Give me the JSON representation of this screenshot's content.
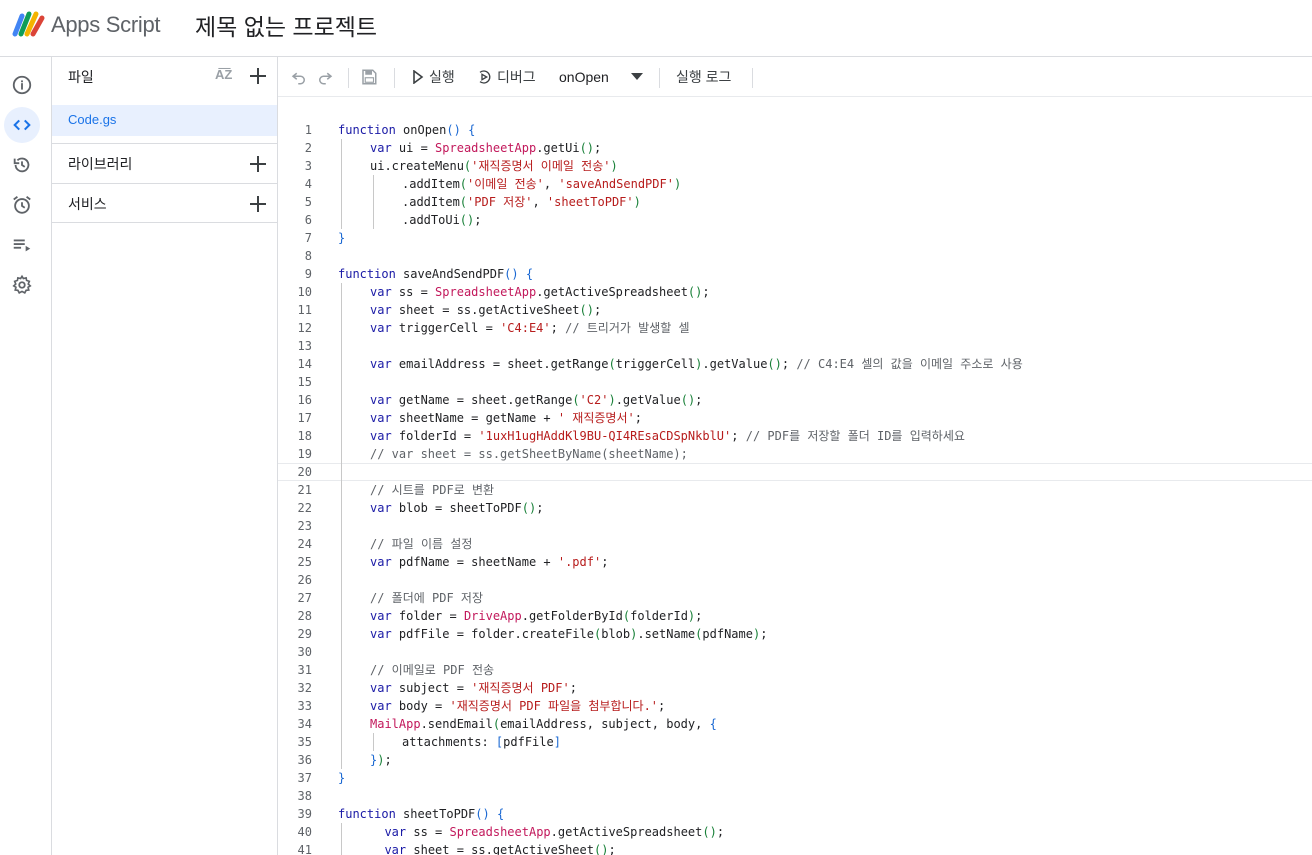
{
  "header": {
    "app_name": "Apps Script",
    "project_title": "제목 없는 프로젝트"
  },
  "rail": {
    "items": [
      "overview",
      "editor",
      "triggers-history",
      "triggers",
      "executions",
      "settings"
    ]
  },
  "files_panel": {
    "title": "파일",
    "files": [
      "Code.gs"
    ],
    "sections": [
      "라이브러리",
      "서비스"
    ]
  },
  "toolbar": {
    "run_label": "실행",
    "debug_label": "디버그",
    "function_selected": "onOpen",
    "log_label": "실행 로그"
  },
  "colors": {
    "accent": "#1a73e8",
    "selected_bg": "#e8f0fe",
    "keyword": "#1a1aa6",
    "class": "#c2185b",
    "string": "#b71c1c"
  },
  "code": {
    "current_line": 20,
    "lines": [
      {
        "n": "1",
        "indent": 0,
        "t": [
          [
            "kw",
            "function"
          ],
          [
            "fn",
            " onOpen"
          ],
          [
            "par1",
            "()"
          ],
          [
            "punc",
            " "
          ],
          [
            "par1",
            "{"
          ]
        ]
      },
      {
        "n": "2",
        "indent": 1,
        "t": [
          [
            "kw",
            "var"
          ],
          [
            "fn",
            " ui = "
          ],
          [
            "cls",
            "SpreadsheetApp"
          ],
          [
            "fn",
            ".getUi"
          ],
          [
            "par2",
            "()"
          ],
          [
            "punc",
            ";"
          ]
        ]
      },
      {
        "n": "3",
        "indent": 1,
        "t": [
          [
            "fn",
            "ui.createMenu"
          ],
          [
            "par2",
            "("
          ],
          [
            "str",
            "'재직증명서 이메일 전송'"
          ],
          [
            "par2",
            ")"
          ]
        ]
      },
      {
        "n": "4",
        "indent": 2,
        "t": [
          [
            "fn",
            ".addItem"
          ],
          [
            "par2",
            "("
          ],
          [
            "str",
            "'이메일 전송'"
          ],
          [
            "fn",
            ", "
          ],
          [
            "str",
            "'saveAndSendPDF'"
          ],
          [
            "par2",
            ")"
          ]
        ]
      },
      {
        "n": "5",
        "indent": 2,
        "t": [
          [
            "fn",
            ".addItem"
          ],
          [
            "par2",
            "("
          ],
          [
            "str",
            "'PDF 저장'"
          ],
          [
            "fn",
            ", "
          ],
          [
            "str",
            "'sheetToPDF'"
          ],
          [
            "par2",
            ")"
          ]
        ]
      },
      {
        "n": "6",
        "indent": 2,
        "t": [
          [
            "fn",
            ".addToUi"
          ],
          [
            "par2",
            "()"
          ],
          [
            "punc",
            ";"
          ]
        ]
      },
      {
        "n": "7",
        "indent": 0,
        "t": [
          [
            "par1",
            "}"
          ]
        ]
      },
      {
        "n": "8",
        "indent": 0,
        "t": []
      },
      {
        "n": "9",
        "indent": 0,
        "t": [
          [
            "kw",
            "function"
          ],
          [
            "fn",
            " saveAndSendPDF"
          ],
          [
            "par1",
            "()"
          ],
          [
            "punc",
            " "
          ],
          [
            "par1",
            "{"
          ]
        ]
      },
      {
        "n": "10",
        "indent": 1,
        "t": [
          [
            "kw",
            "var"
          ],
          [
            "fn",
            " ss = "
          ],
          [
            "cls",
            "SpreadsheetApp"
          ],
          [
            "fn",
            ".getActiveSpreadsheet"
          ],
          [
            "par2",
            "()"
          ],
          [
            "punc",
            ";"
          ]
        ]
      },
      {
        "n": "11",
        "indent": 1,
        "t": [
          [
            "kw",
            "var"
          ],
          [
            "fn",
            " sheet = ss.getActiveSheet"
          ],
          [
            "par2",
            "()"
          ],
          [
            "punc",
            ";"
          ]
        ]
      },
      {
        "n": "12",
        "indent": 1,
        "t": [
          [
            "kw",
            "var"
          ],
          [
            "fn",
            " triggerCell = "
          ],
          [
            "str",
            "'C4:E4'"
          ],
          [
            "punc",
            "; "
          ],
          [
            "cm",
            "// 트리거가 발생할 셀"
          ]
        ]
      },
      {
        "n": "13",
        "indent": 1,
        "t": []
      },
      {
        "n": "14",
        "indent": 1,
        "t": [
          [
            "kw",
            "var"
          ],
          [
            "fn",
            " emailAddress = sheet.getRange"
          ],
          [
            "par2",
            "("
          ],
          [
            "fn",
            "triggerCell"
          ],
          [
            "par2",
            ")"
          ],
          [
            "fn",
            ".getValue"
          ],
          [
            "par2",
            "()"
          ],
          [
            "punc",
            "; "
          ],
          [
            "cm",
            "// C4:E4 셀의 값을 이메일 주소로 사용"
          ]
        ]
      },
      {
        "n": "15",
        "indent": 1,
        "t": []
      },
      {
        "n": "16",
        "indent": 1,
        "t": [
          [
            "kw",
            "var"
          ],
          [
            "fn",
            " getName = sheet.getRange"
          ],
          [
            "par2",
            "("
          ],
          [
            "str",
            "'C2'"
          ],
          [
            "par2",
            ")"
          ],
          [
            "fn",
            ".getValue"
          ],
          [
            "par2",
            "()"
          ],
          [
            "punc",
            ";"
          ]
        ]
      },
      {
        "n": "17",
        "indent": 1,
        "t": [
          [
            "kw",
            "var"
          ],
          [
            "fn",
            " sheetName = getName + "
          ],
          [
            "str",
            "' 재직증명서'"
          ],
          [
            "punc",
            ";"
          ]
        ]
      },
      {
        "n": "18",
        "indent": 1,
        "t": [
          [
            "kw",
            "var"
          ],
          [
            "fn",
            " folderId = "
          ],
          [
            "str",
            "'1uxH1ugHAddKl9BU-QI4REsaCDSpNkblU'"
          ],
          [
            "punc",
            "; "
          ],
          [
            "cm",
            "// PDF를 저장할 폴더 ID를 입력하세요"
          ]
        ]
      },
      {
        "n": "19",
        "indent": 1,
        "t": [
          [
            "cm",
            "// var sheet = ss.getSheetByName(sheetName);"
          ]
        ]
      },
      {
        "n": "20",
        "indent": 1,
        "t": []
      },
      {
        "n": "21",
        "indent": 1,
        "t": [
          [
            "cm",
            "// 시트를 PDF로 변환"
          ]
        ]
      },
      {
        "n": "22",
        "indent": 1,
        "t": [
          [
            "kw",
            "var"
          ],
          [
            "fn",
            " blob = sheetToPDF"
          ],
          [
            "par2",
            "()"
          ],
          [
            "punc",
            ";"
          ]
        ]
      },
      {
        "n": "23",
        "indent": 1,
        "t": []
      },
      {
        "n": "24",
        "indent": 1,
        "t": [
          [
            "cm",
            "// 파일 이름 설정"
          ]
        ]
      },
      {
        "n": "25",
        "indent": 1,
        "t": [
          [
            "kw",
            "var"
          ],
          [
            "fn",
            " pdfName = sheetName + "
          ],
          [
            "str",
            "'.pdf'"
          ],
          [
            "punc",
            ";"
          ]
        ]
      },
      {
        "n": "26",
        "indent": 1,
        "t": []
      },
      {
        "n": "27",
        "indent": 1,
        "t": [
          [
            "cm",
            "// 폴더에 PDF 저장"
          ]
        ]
      },
      {
        "n": "28",
        "indent": 1,
        "t": [
          [
            "kw",
            "var"
          ],
          [
            "fn",
            " folder = "
          ],
          [
            "cls",
            "DriveApp"
          ],
          [
            "fn",
            ".getFolderById"
          ],
          [
            "par2",
            "("
          ],
          [
            "fn",
            "folderId"
          ],
          [
            "par2",
            ")"
          ],
          [
            "punc",
            ";"
          ]
        ]
      },
      {
        "n": "29",
        "indent": 1,
        "t": [
          [
            "kw",
            "var"
          ],
          [
            "fn",
            " pdfFile = folder.createFile"
          ],
          [
            "par2",
            "("
          ],
          [
            "fn",
            "blob"
          ],
          [
            "par2",
            ")"
          ],
          [
            "fn",
            ".setName"
          ],
          [
            "par2",
            "("
          ],
          [
            "fn",
            "pdfName"
          ],
          [
            "par2",
            ")"
          ],
          [
            "punc",
            ";"
          ]
        ]
      },
      {
        "n": "30",
        "indent": 1,
        "t": []
      },
      {
        "n": "31",
        "indent": 1,
        "t": [
          [
            "cm",
            "// 이메일로 PDF 전송"
          ]
        ]
      },
      {
        "n": "32",
        "indent": 1,
        "t": [
          [
            "kw",
            "var"
          ],
          [
            "fn",
            " subject = "
          ],
          [
            "str",
            "'재직증명서 PDF'"
          ],
          [
            "punc",
            ";"
          ]
        ]
      },
      {
        "n": "33",
        "indent": 1,
        "t": [
          [
            "kw",
            "var"
          ],
          [
            "fn",
            " body = "
          ],
          [
            "str",
            "'재직증명서 PDF 파일을 첨부합니다.'"
          ],
          [
            "punc",
            ";"
          ]
        ]
      },
      {
        "n": "34",
        "indent": 1,
        "t": [
          [
            "cls",
            "MailApp"
          ],
          [
            "fn",
            ".sendEmail"
          ],
          [
            "par2",
            "("
          ],
          [
            "fn",
            "emailAddress, subject, body, "
          ],
          [
            "par1",
            "{"
          ]
        ]
      },
      {
        "n": "35",
        "indent": 2,
        "t": [
          [
            "fn",
            "attachments: "
          ],
          [
            "par1",
            "["
          ],
          [
            "fn",
            "pdfFile"
          ],
          [
            "par1",
            "]"
          ]
        ]
      },
      {
        "n": "36",
        "indent": 1,
        "t": [
          [
            "par1",
            "}"
          ],
          [
            "par2",
            ")"
          ],
          [
            "punc",
            ";"
          ]
        ]
      },
      {
        "n": "37",
        "indent": 0,
        "t": [
          [
            "par1",
            "}"
          ]
        ]
      },
      {
        "n": "38",
        "indent": 0,
        "t": []
      },
      {
        "n": "39",
        "indent": 0,
        "t": [
          [
            "kw",
            "function"
          ],
          [
            "fn",
            " sheetToPDF"
          ],
          [
            "par1",
            "()"
          ],
          [
            "punc",
            " "
          ],
          [
            "par1",
            "{"
          ]
        ]
      },
      {
        "n": "40",
        "indent": 1,
        "t": [
          [
            "fn",
            "  "
          ],
          [
            "kw",
            "var"
          ],
          [
            "fn",
            " ss = "
          ],
          [
            "cls",
            "SpreadsheetApp"
          ],
          [
            "fn",
            ".getActiveSpreadsheet"
          ],
          [
            "par2",
            "()"
          ],
          [
            "punc",
            ";"
          ]
        ]
      },
      {
        "n": "41",
        "indent": 1,
        "t": [
          [
            "fn",
            "  "
          ],
          [
            "kw",
            "var"
          ],
          [
            "fn",
            " sheet = ss.getActiveSheet"
          ],
          [
            "par2",
            "()"
          ],
          [
            "punc",
            ";"
          ]
        ]
      }
    ]
  }
}
